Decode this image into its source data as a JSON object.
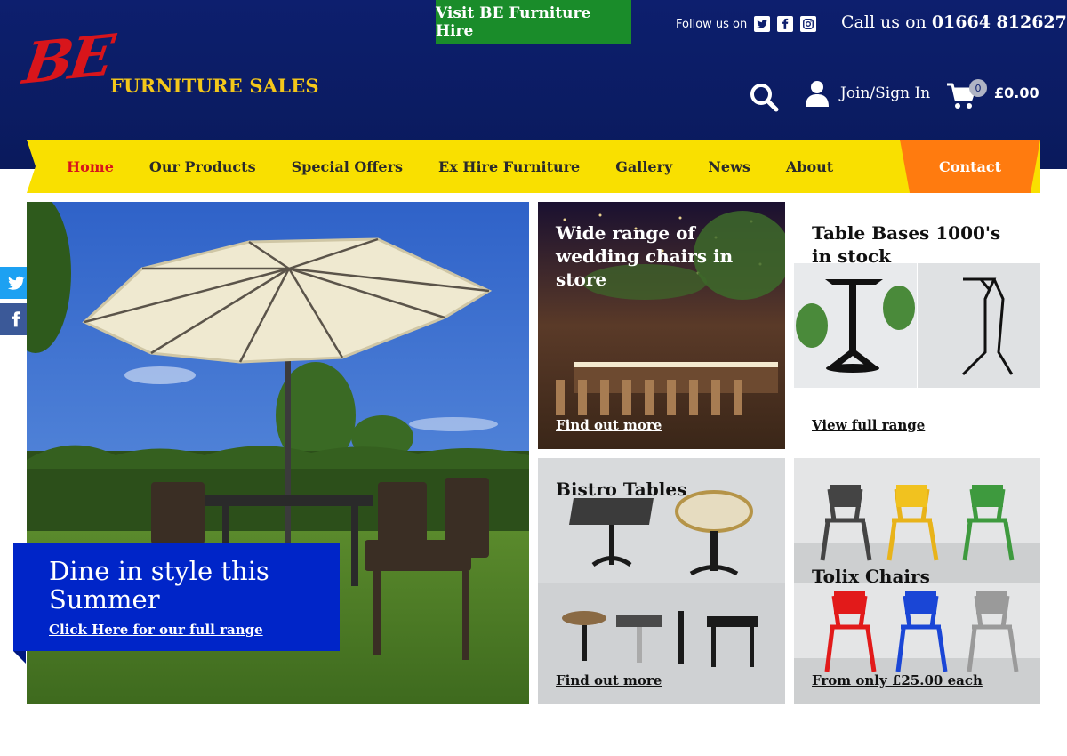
{
  "header": {
    "hire_button": "Visit BE Furniture Hire",
    "follow_label": "Follow us on",
    "call_prefix": "Call us on",
    "phone": "01664 812627",
    "logo_be": "BE",
    "logo_sub": "FURNITURE SALES",
    "account_label": "Join/Sign In",
    "cart_count": "0",
    "cart_total": "£0.00"
  },
  "nav": {
    "items": [
      "Home",
      "Our Products",
      "Special Offers",
      "Ex Hire Furniture",
      "Gallery",
      "News",
      "About"
    ],
    "contact": "Contact"
  },
  "hero": {
    "title": "Dine in style this Summer",
    "link": "Click Here for our full range"
  },
  "tiles": {
    "wedding": {
      "title": "Wide range of wedding chairs in store",
      "link": "Find out more"
    },
    "bases": {
      "title": "Table Bases 1000's in stock",
      "link": "View full range"
    },
    "bistro": {
      "title": "Bistro Tables",
      "link": "Find out more"
    },
    "tolix": {
      "title": "Tolix Chairs",
      "link": "From only £25.00 each"
    }
  },
  "colors": {
    "header_navy": "#0d1f6e",
    "nav_yellow": "#f9e000",
    "contact_orange": "#ff7b0f",
    "hire_green": "#1a8c2a",
    "hero_card_blue": "#0025c8",
    "active_red": "#d8151b"
  },
  "icons": [
    "twitter-icon",
    "facebook-icon",
    "instagram-icon",
    "search-icon",
    "user-icon",
    "cart-icon"
  ]
}
